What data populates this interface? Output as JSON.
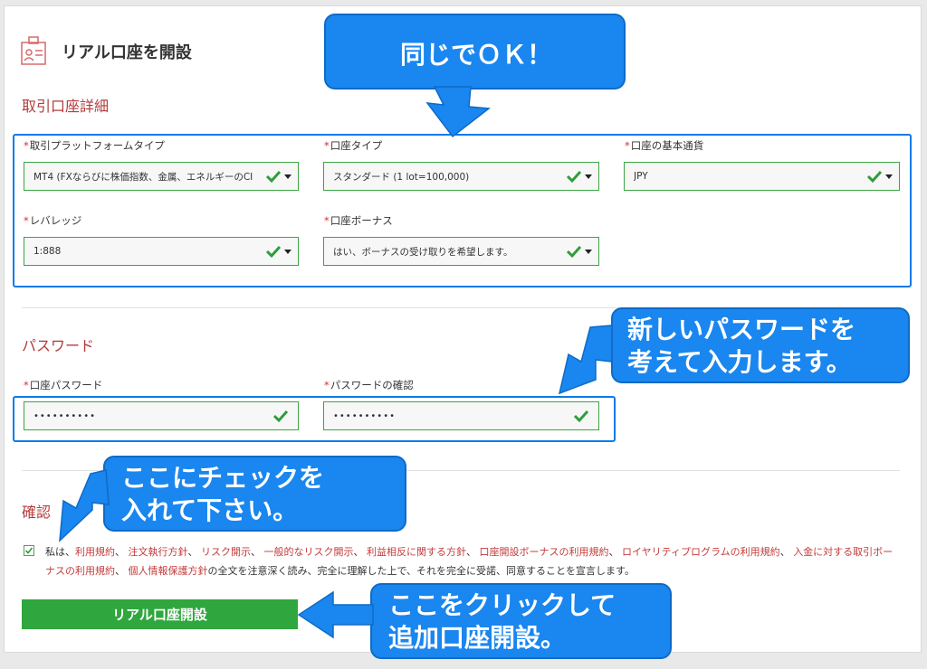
{
  "page": {
    "title": "リアル口座を開設"
  },
  "sections": {
    "account_details": "取引口座詳細",
    "password": "パスワード",
    "confirm": "確認"
  },
  "account": {
    "platform": {
      "label": "取引プラットフォームタイプ",
      "value": "MT4 (FXならびに株価指数、金属、エネルギーのCI"
    },
    "type": {
      "label": "口座タイプ",
      "value": "スタンダード (1 lot=100,000)"
    },
    "currency": {
      "label": "口座の基本通貨",
      "value": "JPY"
    },
    "leverage": {
      "label": "レバレッジ",
      "value": "1:888"
    },
    "bonus": {
      "label": "口座ボーナス",
      "value": "はい、ボーナスの受け取りを希望します。"
    }
  },
  "password": {
    "pw": {
      "label": "口座パスワード",
      "value": "••••••••••"
    },
    "confirm": {
      "label": "パスワードの確認",
      "value": "••••••••••"
    }
  },
  "required_mark": "*",
  "agreement": {
    "prefix": "私は、",
    "links": [
      "利用規約",
      "注文執行方針",
      "リスク開示",
      "一般的なリスク開示",
      "利益相反に関する方針",
      "口座開設ボーナスの利用規約",
      "ロイヤリティプログラムの利用規約",
      "入金に対する取引ボーナスの利用規約",
      "個人情報保護方針"
    ],
    "sep": "、",
    "suffix": "の全文を注意深く読み、完全に理解した上で、それを完全に受諾、同意することを宣言します。"
  },
  "submit_label": "リアル口座開設",
  "callouts": {
    "same": "同じでＯＫ！",
    "new_password_1": "新しいパスワードを",
    "new_password_2": "考えて入力します。",
    "check_1": "ここにチェックを",
    "check_2": "入れて下さい。",
    "click_1": "ここをクリックして",
    "click_2": "追加口座開設。"
  },
  "colors": {
    "accent_blue": "#1a86ef",
    "valid_green": "#3ca544",
    "section_red": "#b33b3b",
    "button_green": "#2fa63e"
  }
}
